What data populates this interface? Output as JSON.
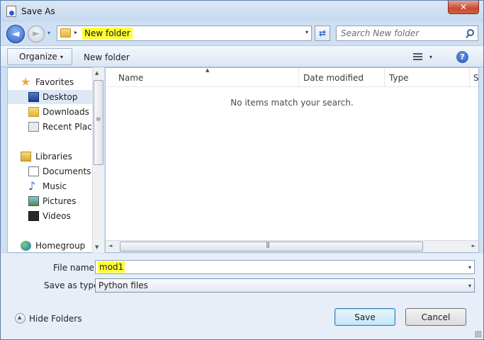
{
  "window": {
    "title": "Save As",
    "close_glyph": "✕"
  },
  "nav": {
    "back_glyph": "◄",
    "forward_glyph": "►",
    "breadcrumb_separator": "▸",
    "address_folder": "New folder",
    "dropdown_glyph": "▾",
    "refresh_glyph": "⇄",
    "search_placeholder": "Search New folder"
  },
  "toolbar": {
    "organize_label": "Organize",
    "organize_caret": "▾",
    "new_folder_label": "New folder",
    "view_caret": "▾",
    "help_glyph": "?"
  },
  "sidebar": {
    "favorites": {
      "label": "Favorites",
      "icon": "star-icon"
    },
    "favorites_items": [
      {
        "label": "Desktop",
        "icon": "desktop-icon",
        "selected": true
      },
      {
        "label": "Downloads",
        "icon": "downloads-icon"
      },
      {
        "label": "Recent Places",
        "icon": "recent-places-icon"
      }
    ],
    "libraries": {
      "label": "Libraries",
      "icon": "libraries-icon"
    },
    "libraries_items": [
      {
        "label": "Documents",
        "icon": "documents-icon"
      },
      {
        "label": "Music",
        "icon": "music-icon"
      },
      {
        "label": "Pictures",
        "icon": "pictures-icon"
      },
      {
        "label": "Videos",
        "icon": "videos-icon"
      }
    ],
    "homegroup": {
      "label": "Homegroup",
      "icon": "homegroup-icon"
    }
  },
  "file_list": {
    "columns": [
      "Name",
      "Date modified",
      "Type",
      "Size"
    ],
    "empty_message": "No items match your search.",
    "sort_glyph": "▲"
  },
  "scroll": {
    "up": "▲",
    "down": "▼",
    "left": "◄",
    "right": "►"
  },
  "form": {
    "file_name_label": "File name:",
    "file_name_value": "mod1",
    "save_type_label": "Save as type:",
    "save_type_value": "Python files",
    "dropdown_glyph": "▾"
  },
  "footer": {
    "hide_folders_label": "Hide Folders",
    "save_label": "Save",
    "cancel_label": "Cancel"
  },
  "colors": {
    "highlight": "#ffff33",
    "window_frame": "#cfe0f3",
    "accent": "#2a5fc4"
  }
}
